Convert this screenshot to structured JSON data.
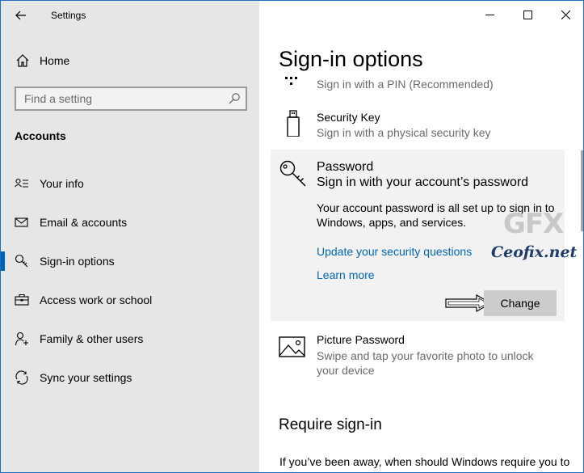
{
  "window": {
    "app_title": "Settings",
    "caption": {
      "minimize": "minimize",
      "maximize": "maximize",
      "close": "close"
    }
  },
  "sidebar": {
    "home_label": "Home",
    "search_placeholder": "Find a setting",
    "section_title": "Accounts",
    "items": [
      {
        "label": "Your info",
        "icon": "person-card-icon",
        "active": false
      },
      {
        "label": "Email & accounts",
        "icon": "mail-icon",
        "active": false
      },
      {
        "label": "Sign-in options",
        "icon": "key-icon",
        "active": true
      },
      {
        "label": "Access work or school",
        "icon": "briefcase-icon",
        "active": false
      },
      {
        "label": "Family & other users",
        "icon": "person-add-icon",
        "active": false
      },
      {
        "label": "Sync your settings",
        "icon": "sync-icon",
        "active": false
      }
    ]
  },
  "main": {
    "title": "Sign-in options",
    "pin": {
      "desc": "Sign in with a PIN (Recommended)"
    },
    "security_key": {
      "name": "Security Key",
      "desc": "Sign in with a physical security key"
    },
    "password": {
      "name": "Password",
      "desc": "Sign in with your account’s password",
      "body": "Your account password is all set up to sign in to Windows, apps, and services.",
      "link_questions": "Update your security questions",
      "link_learn": "Learn more",
      "change_label": "Change"
    },
    "picture_password": {
      "name": "Picture Password",
      "desc_line1": "Swipe and tap your favorite photo to unlock",
      "desc_line2": "your device"
    },
    "require_signin": {
      "title": "Require sign-in",
      "body": "If you’ve been away, when should Windows require you to sign in again?"
    }
  },
  "watermark": {
    "logo": "GFX",
    "text": "Ceofix.net"
  },
  "colors": {
    "sidebar_bg": "#e6e6e6",
    "accent": "#0063b1",
    "link": "#0067b8",
    "selected_box": "#f2f2f2"
  }
}
